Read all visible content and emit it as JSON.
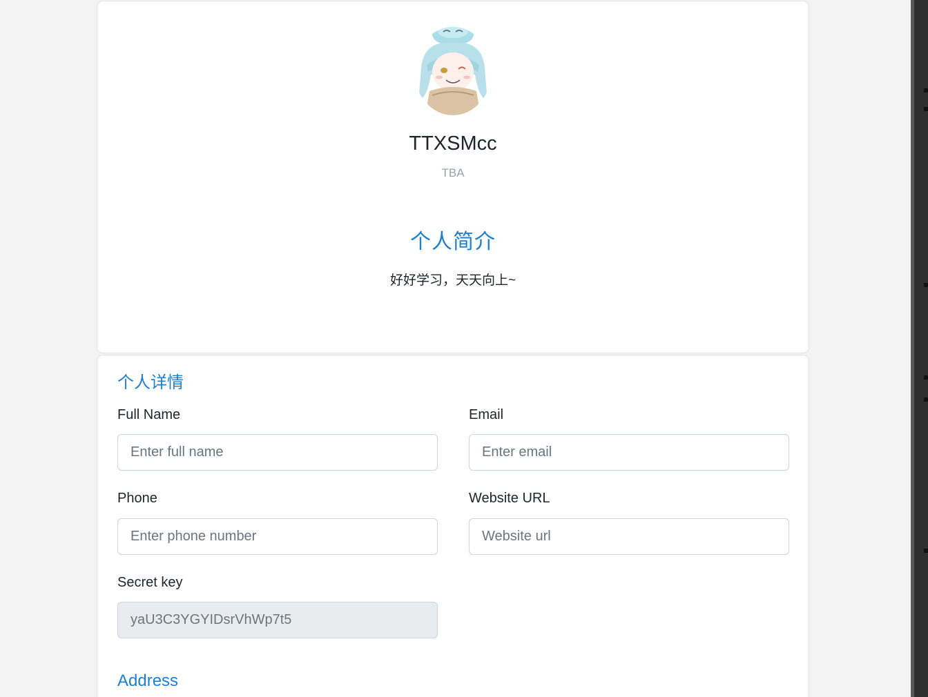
{
  "profile": {
    "avatar_icon": "anime-girl-avatar",
    "name": "TTXSMcc",
    "role": "TBA",
    "bio_title": "个人简介",
    "bio_text": "好好学习，天天向上~"
  },
  "details": {
    "title": "个人详情",
    "fields": {
      "full_name": {
        "label": "Full Name",
        "placeholder": "Enter full name",
        "value": ""
      },
      "email": {
        "label": "Email",
        "placeholder": "Enter email",
        "value": ""
      },
      "phone": {
        "label": "Phone",
        "placeholder": "Enter phone number",
        "value": ""
      },
      "website": {
        "label": "Website URL",
        "placeholder": "Website url",
        "value": ""
      },
      "secret_key": {
        "label": "Secret key",
        "placeholder": "",
        "value": "yaU3C3YGYIDsrVhWp7t5"
      }
    },
    "address_title": "Address"
  },
  "colors": {
    "accent": "#1e7fd0",
    "page_background": "#f3f3f3",
    "card_background": "#ffffff"
  }
}
